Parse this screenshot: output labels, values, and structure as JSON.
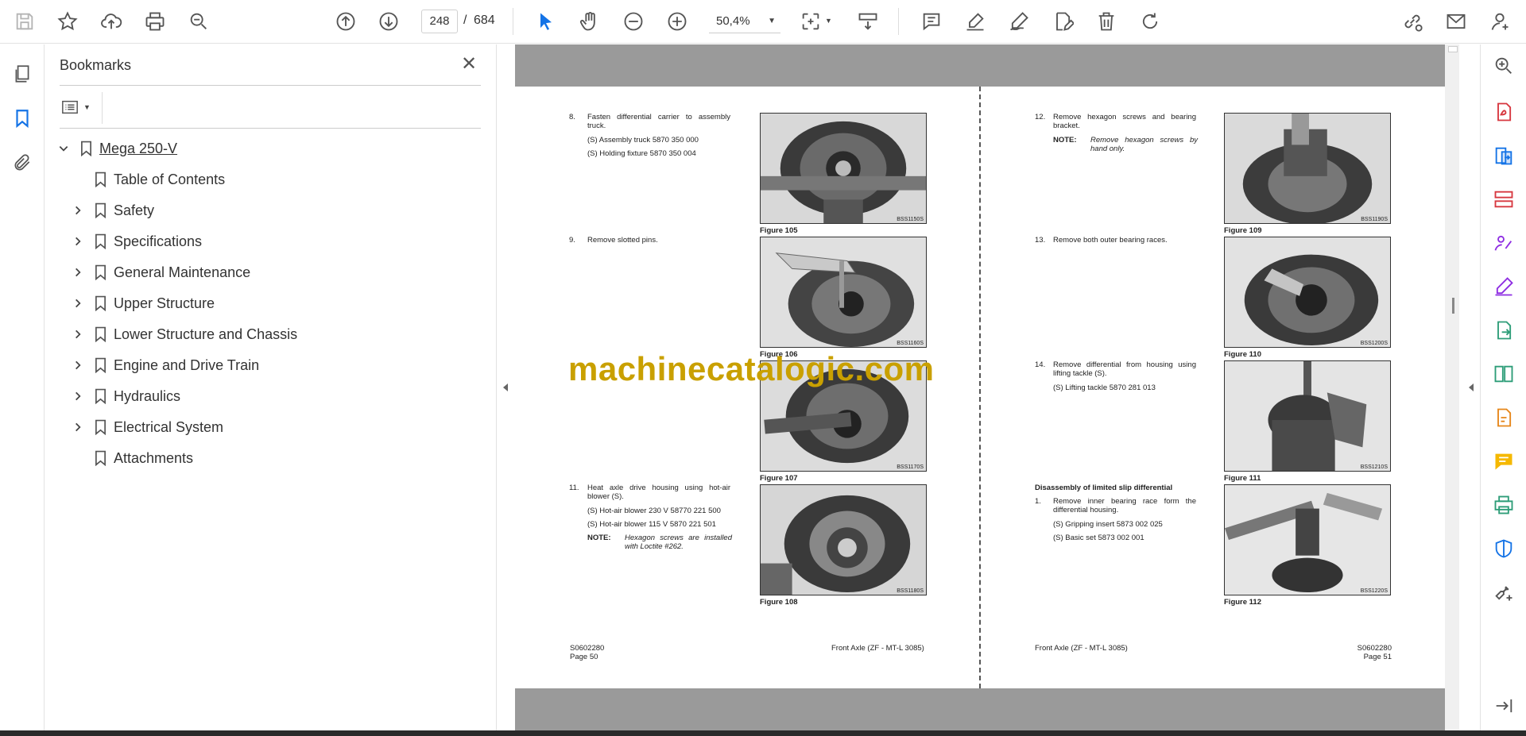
{
  "toolbar": {
    "page_current": "248",
    "page_separator": "/",
    "page_total": "684",
    "zoom": "50,4%",
    "icons": [
      "save-icon",
      "star-icon",
      "upload-icon",
      "print-icon",
      "zoom-search-icon",
      "page-up-icon",
      "page-down-icon",
      "select-cursor-icon",
      "hand-icon",
      "zoom-out-icon",
      "zoom-in-icon",
      "fit-page-icon",
      "scroll-mode-icon",
      "comment-icon",
      "highlight-icon",
      "draw-icon",
      "edit-icon",
      "delete-icon",
      "rotate-icon",
      "share-link-icon",
      "mail-icon",
      "account-icon"
    ]
  },
  "left_rail": {
    "icons": [
      "pages-icon",
      "bookmark-icon",
      "attachment-icon"
    ]
  },
  "bookmarks": {
    "title": "Bookmarks",
    "root": {
      "label": "Mega 250-V"
    },
    "items": [
      {
        "label": "Table of Contents",
        "expandable": false
      },
      {
        "label": "Safety",
        "expandable": true
      },
      {
        "label": "Specifications",
        "expandable": true
      },
      {
        "label": "General Maintenance",
        "expandable": true
      },
      {
        "label": "Upper Structure",
        "expandable": true
      },
      {
        "label": "Lower Structure and Chassis",
        "expandable": true
      },
      {
        "label": "Engine and Drive Train",
        "expandable": true
      },
      {
        "label": "Hydraulics",
        "expandable": true
      },
      {
        "label": "Electrical System",
        "expandable": true
      },
      {
        "label": "Attachments",
        "expandable": false
      }
    ]
  },
  "left_page": {
    "steps": [
      {
        "num": "8.",
        "text": "Fasten differential carrier to assembly truck."
      },
      {
        "num": "9.",
        "text": "Remove slotted pins."
      },
      {
        "num": "11.",
        "text": "Heat axle drive housing using hot-air blower (S)."
      }
    ],
    "sub_lines": [
      "(S) Assembly truck 5870 350 000",
      "(S) Holding fixture 5870 350 004",
      "(S) Hot-air blower 230 V 58770 221 500",
      "(S) Hot-air blower 115 V 5870 221 501"
    ],
    "note_label": "NOTE:",
    "note_text": "Hexagon screws are installed with Loctite #262.",
    "figures": [
      {
        "caption": "Figure 105",
        "code": "BSS1150S"
      },
      {
        "caption": "Figure 106",
        "code": "BSS1160S"
      },
      {
        "caption": "Figure 107",
        "code": "BSS1170S"
      },
      {
        "caption": "Figure 108",
        "code": "BSS1180S"
      }
    ],
    "footer_code": "S0602280",
    "footer_page": "Page 50",
    "footer_title": "Front Axle (ZF - MT-L 3085)"
  },
  "right_page": {
    "steps": [
      {
        "num": "12.",
        "text": "Remove hexagon screws and bearing bracket."
      },
      {
        "num": "13.",
        "text": "Remove both outer bearing races."
      },
      {
        "num": "14.",
        "text": "Remove differential from housing using lifting tackle (S)."
      },
      {
        "num": "1.",
        "text": "Remove inner bearing race form the differential housing."
      }
    ],
    "note_label": "NOTE:",
    "note_text": "Remove hexagon screws by hand only.",
    "sub_lines": [
      "(S) Lifting tackle 5870 281 013",
      "(S) Gripping insert 5873 002 025",
      "(S) Basic set 5873 002 001"
    ],
    "section_heading": "Disassembly of limited slip differential",
    "figures": [
      {
        "caption": "Figure 109",
        "code": "BSS1190S"
      },
      {
        "caption": "Figure 110",
        "code": "BSS1200S"
      },
      {
        "caption": "Figure 111",
        "code": "BSS1210S"
      },
      {
        "caption": "Figure 112",
        "code": "BSS1220S"
      }
    ],
    "footer_title": "Front Axle (ZF - MT-L 3085)",
    "footer_code": "S0602280",
    "footer_page": "Page 51"
  },
  "watermark": "machinecatalogic.com",
  "right_rail": {
    "icons": [
      "zoom-search-icon",
      "export-pdf-icon",
      "create-pdf-icon",
      "organize-pages-icon",
      "request-signature-icon",
      "fill-sign-icon",
      "export-icon",
      "compare-icon",
      "edit-pdf-icon",
      "comment-icon",
      "print-production-icon",
      "protect-icon",
      "more-tools-icon",
      "collapse-panel-icon"
    ]
  },
  "colors": {
    "accent_blue": "#1473e6",
    "brand_red": "#d7373f",
    "purple": "#8e2de2",
    "green": "#2d9d78",
    "gold": "#c9a000",
    "doc_bg": "#9a9a9a"
  }
}
